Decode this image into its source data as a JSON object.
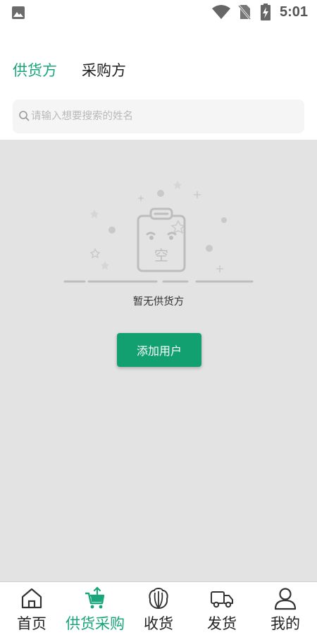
{
  "status_bar": {
    "time": "5:01",
    "icons": [
      "gallery-icon",
      "wifi-icon",
      "no-sim-icon",
      "battery-charging-icon"
    ]
  },
  "tabs": [
    {
      "label": "供货方",
      "active": true
    },
    {
      "label": "采购方",
      "active": false
    }
  ],
  "search": {
    "placeholder": "请输入想要搜索的姓名",
    "value": ""
  },
  "empty": {
    "illustration_text": "空",
    "message": "暂无供货方"
  },
  "actions": {
    "add_user_label": "添加用户"
  },
  "bottom_nav": [
    {
      "label": "首页",
      "icon": "home-icon",
      "active": false
    },
    {
      "label": "供货采购",
      "icon": "cart-icon",
      "active": true
    },
    {
      "label": "收货",
      "icon": "receive-icon",
      "active": false
    },
    {
      "label": "发货",
      "icon": "truck-icon",
      "active": false
    },
    {
      "label": "我的",
      "icon": "user-icon",
      "active": false
    }
  ],
  "colors": {
    "accent": "#1aa57a",
    "button": "#12a071",
    "content_bg": "#e3e3e3",
    "search_bg": "#f5f5f5"
  }
}
